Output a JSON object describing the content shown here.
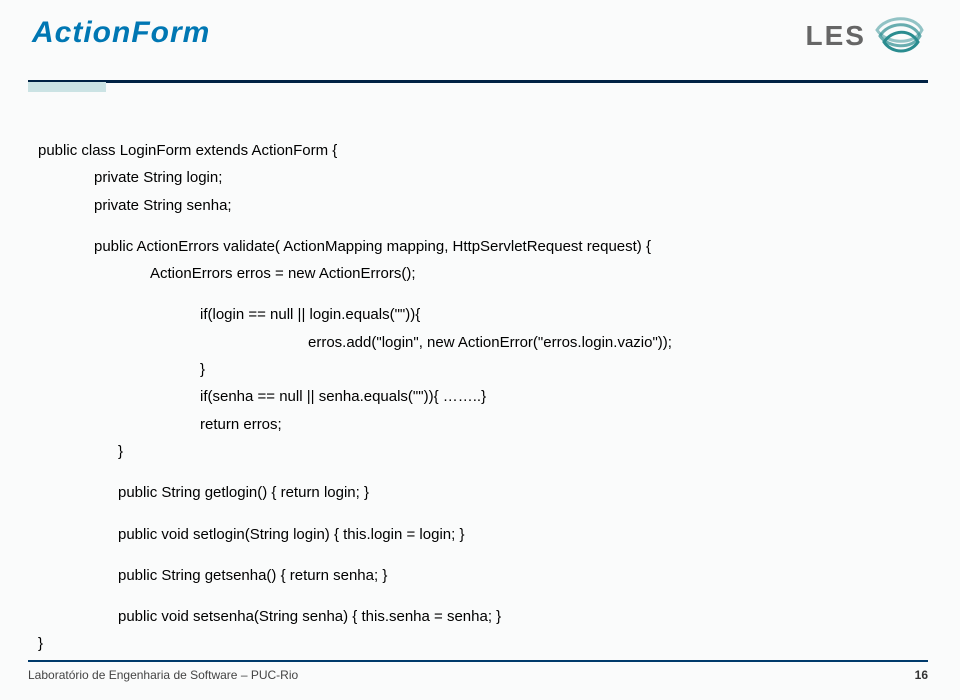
{
  "header": {
    "title": "ActionForm",
    "logo_text": "LES"
  },
  "code": {
    "l01": "public class LoginForm extends ActionForm {",
    "l02": "private String login;",
    "l03": "private String senha;",
    "l04": "public ActionErrors validate( ActionMapping mapping, HttpServletRequest request) {",
    "l05": "ActionErrors erros = new ActionErrors();",
    "l06": "if(login == null || login.equals(\"\")){",
    "l07": "erros.add(\"login\", new ActionError(\"erros.login.vazio\"));",
    "l08": "}",
    "l09": "if(senha == null || senha.equals(\"\")){ ……..}",
    "l10": "return erros;",
    "l11": "}",
    "l12": "public String getlogin() { return login; }",
    "l13": "public void setlogin(String login) { this.login = login; }",
    "l14": "public String getsenha() {  return senha; }",
    "l15": "public void setsenha(String senha) {  this.senha = senha; }",
    "l16": "}"
  },
  "footer": {
    "lab": "Laboratório de Engenharia de Software – PUC-Rio",
    "page": "16"
  }
}
